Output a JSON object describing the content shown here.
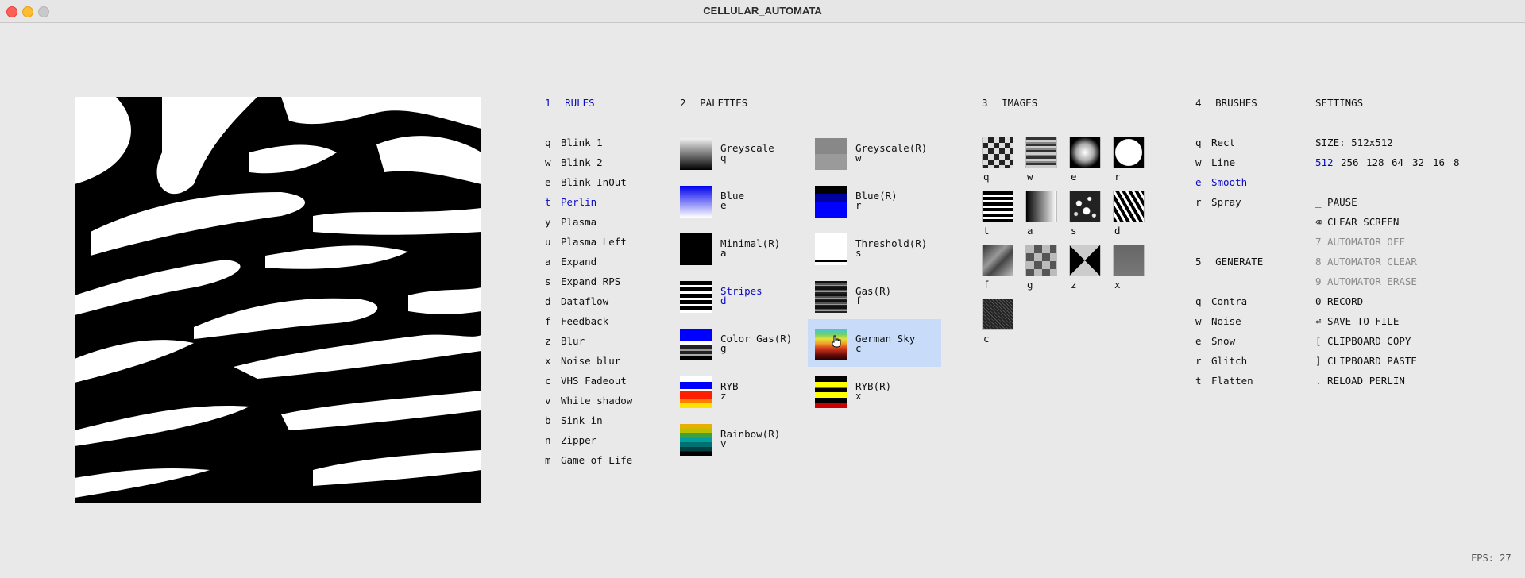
{
  "window": {
    "title": "CELLULAR_AUTOMATA"
  },
  "rules": {
    "num": "1",
    "title": "RULES",
    "items": [
      {
        "key": "q",
        "label": "Blink 1"
      },
      {
        "key": "w",
        "label": "Blink 2"
      },
      {
        "key": "e",
        "label": "Blink InOut"
      },
      {
        "key": "t",
        "label": "Perlin",
        "selected": true
      },
      {
        "key": "y",
        "label": "Plasma"
      },
      {
        "key": "u",
        "label": "Plasma Left"
      },
      {
        "key": "a",
        "label": "Expand"
      },
      {
        "key": "s",
        "label": "Expand RPS"
      },
      {
        "key": "d",
        "label": "Dataflow"
      },
      {
        "key": "f",
        "label": "Feedback"
      },
      {
        "key": "z",
        "label": "Blur"
      },
      {
        "key": "x",
        "label": "Noise blur"
      },
      {
        "key": "c",
        "label": "VHS Fadeout"
      },
      {
        "key": "v",
        "label": "White shadow"
      },
      {
        "key": "b",
        "label": "Sink in"
      },
      {
        "key": "n",
        "label": "Zipper"
      },
      {
        "key": "m",
        "label": "Game of Life"
      }
    ]
  },
  "palettes": {
    "num": "2",
    "title": "PALETTES",
    "items": [
      {
        "name": "Greyscale",
        "key": "q",
        "swatch": "linear-gradient(#f2f2f2,#000)"
      },
      {
        "name": "Greyscale(R)",
        "key": "w",
        "swatch": "linear-gradient(#888 0 50%,#9a9a9a 50% 100%)"
      },
      {
        "name": "Blue",
        "key": "e",
        "swatch": "linear-gradient(#0000ee,#ffffff)"
      },
      {
        "name": "Blue(R)",
        "key": "r",
        "swatch": "linear-gradient(#000 0 25%,#0000a0 25% 50%,#0000ff 50% 100%)"
      },
      {
        "name": "Minimal(R)",
        "key": "a",
        "swatch": "#000000"
      },
      {
        "name": "Threshold(R)",
        "key": "s",
        "swatch": "linear-gradient(#ffffff 0 82%,#000 82% 90%,#fff 90% 100%)"
      },
      {
        "name": "Stripes",
        "key": "d",
        "selected": true,
        "swatch": "repeating-linear-gradient(#000 0 5px,#fff 5px 8px)"
      },
      {
        "name": "Gas(R)",
        "key": "f",
        "swatch": "repeating-linear-gradient(#111 0 3px,#555 3px 5px,#999 5px 6px,#222 6px 8px)"
      },
      {
        "name": "Color Gas(R)",
        "key": "g",
        "swatch": "linear-gradient(#0000ff 0 40%,#fff 40% 50%,#222 50% 62%,#999 62% 70%,#222 70% 80%,#aaa 80% 88%,#000 88% 100%)"
      },
      {
        "name": "German Sky",
        "key": "c",
        "swatch": "linear-gradient(#46c2e8 0%,#6fd06a 18%,#e5e03a 32%,#f2a22a 46%,#d43a1c 62%,#6b0c0c 82%,#1a0000 100%)"
      },
      {
        "name": "RYB",
        "key": "z",
        "swatch": "linear-gradient(#fff 0 18%,#0000ff 18% 40%,#fff 40% 48%,#ff2000 48% 70%,#ff8000 70% 84%,#ffe000 84% 100%)"
      },
      {
        "name": "RYB(R)",
        "key": "x",
        "swatch": "linear-gradient(#000 0 18%,#ffff00 18% 36%,#000 36% 50%,#ffff00 50% 68%,#000 68% 82%,#cc0000 82% 100%)"
      },
      {
        "name": "Rainbow(R)",
        "key": "v",
        "swatch": "linear-gradient(#e8b000 0 14%,#b8c000 14% 28%,#40a040 28% 44%,#00a0a0 44% 58%,#007070 58% 72%,#004040 72% 86%,#000 86% 100%)"
      }
    ]
  },
  "images": {
    "num": "3",
    "title": "IMAGES",
    "items": [
      {
        "key": "q",
        "icon": "checker-noise-icon",
        "thumb": "repeating-conic-gradient(#222 0 25%,#ddd 0 50%) 0 0/14px 14px"
      },
      {
        "key": "w",
        "icon": "horizontal-stripes-icon",
        "thumb": "repeating-linear-gradient(#333 0 3px,#ccc 3px 6px,#888 6px 8px)"
      },
      {
        "key": "e",
        "icon": "radial-glow-icon",
        "thumb": "radial-gradient(circle,#fff 0%,#aaa 40%,#000 72%)"
      },
      {
        "key": "r",
        "icon": "circle-icon",
        "thumb": "radial-gradient(circle,#fff 0 62%,#000 64%)"
      },
      {
        "key": "t",
        "icon": "bars-icon",
        "thumb": "repeating-linear-gradient(#000 0 4px,#fff 4px 7px)"
      },
      {
        "key": "a",
        "icon": "horizontal-gradient-icon",
        "thumb": "linear-gradient(90deg,#000,#fff)"
      },
      {
        "key": "s",
        "icon": "stars-icon",
        "thumb": "radial-gradient(circle at 30% 40%,#fff 0 3px,transparent 4px),radial-gradient(circle at 65% 25%,#fff 0 2px,transparent 3px),radial-gradient(circle at 55% 65%,#fff 0 4px,transparent 5px),radial-gradient(circle at 20% 75%,#ddd 0 2px,transparent 3px),radial-gradient(circle at 80% 80%,#eee 0 2px,transparent 3px),#222"
      },
      {
        "key": "d",
        "icon": "scribble-icon",
        "thumb": "repeating-linear-gradient(60deg,#000 0 4px,#fff 4px 7px)"
      },
      {
        "key": "f",
        "icon": "blur-noise-icon",
        "thumb": "linear-gradient(135deg,#333,#999 40%,#444 60%,#bbb)"
      },
      {
        "key": "g",
        "icon": "blocks-icon",
        "thumb": "repeating-conic-gradient(#555 0 25%,#bbb 0 50%) 0 0/20px 20px"
      },
      {
        "key": "z",
        "icon": "hourglass-icon",
        "thumb": "conic-gradient(from 45deg,#000 0 25%,#ccc 25% 50%,#000 50% 75%,#ccc 75% 100%)"
      },
      {
        "key": "x",
        "icon": "grey-noise-icon",
        "thumb": "linear-gradient(#666,#777)"
      },
      {
        "key": "c",
        "icon": "dark-texture-icon",
        "thumb": "repeating-linear-gradient(45deg,#222 0 2px,#555 2px 3px),#333"
      }
    ]
  },
  "brushes": {
    "num": "4",
    "title": "BRUSHES",
    "items": [
      {
        "key": "q",
        "label": "Rect"
      },
      {
        "key": "w",
        "label": "Line"
      },
      {
        "key": "e",
        "label": "Smooth",
        "selected": true
      },
      {
        "key": "r",
        "label": "Spray"
      }
    ]
  },
  "generate": {
    "num": "5",
    "title": "GENERATE",
    "items": [
      {
        "key": "q",
        "label": "Contra"
      },
      {
        "key": "w",
        "label": "Noise"
      },
      {
        "key": "e",
        "label": "Snow"
      },
      {
        "key": "r",
        "label": "Glitch"
      },
      {
        "key": "t",
        "label": "Flatten"
      }
    ]
  },
  "settings": {
    "title": "SETTINGS",
    "size_label": "SIZE: 512x512",
    "sizes": [
      {
        "value": "512",
        "selected": true
      },
      {
        "value": "256"
      },
      {
        "value": "128"
      },
      {
        "value": "64"
      },
      {
        "value": "32"
      },
      {
        "value": "16"
      },
      {
        "value": "8"
      }
    ],
    "actions": [
      {
        "text": "_ PAUSE",
        "dim": false
      },
      {
        "text": "⌫ CLEAR SCREEN",
        "dim": false
      },
      {
        "text": "7 AUTOMATOR OFF",
        "dim": true
      },
      {
        "text": "8 AUTOMATOR CLEAR",
        "dim": true
      },
      {
        "text": "9 AUTOMATOR ERASE",
        "dim": true
      },
      {
        "text": "0 RECORD",
        "dim": false
      },
      {
        "text": "⏎ SAVE TO FILE",
        "dim": false
      },
      {
        "text": "[ CLIPBOARD COPY",
        "dim": false
      },
      {
        "text": "] CLIPBOARD PASTE",
        "dim": false
      },
      {
        "text": ". RELOAD PERLIN",
        "dim": false
      }
    ]
  },
  "status": {
    "fps": "FPS: 27"
  },
  "colors": {
    "accent": "#0b0bc4",
    "selected_bg": "#c8dcfa",
    "background": "#e9e9e9"
  }
}
